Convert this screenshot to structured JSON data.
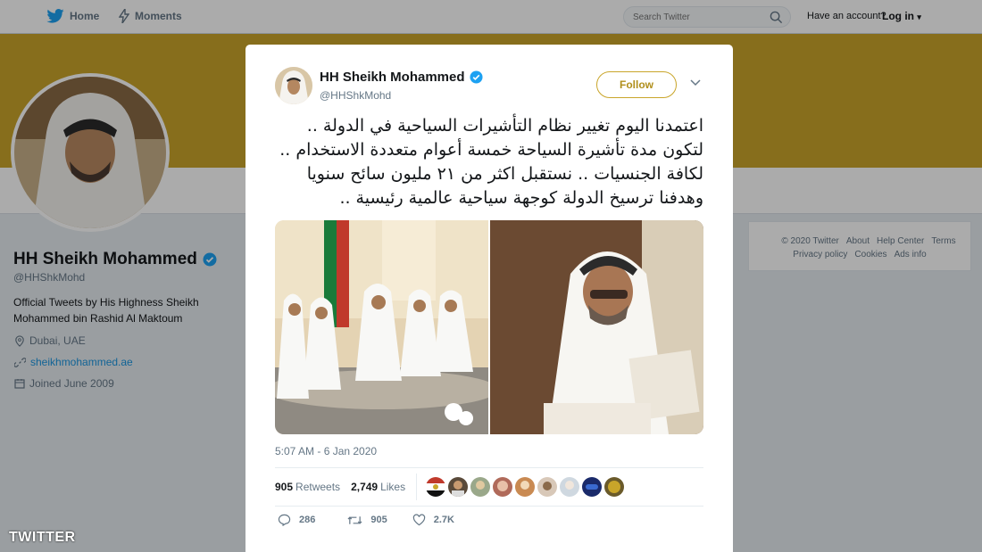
{
  "topnav": {
    "home_label": "Home",
    "moments_label": "Moments",
    "search_placeholder": "Search Twitter",
    "have_account": "Have an account?",
    "login_label": "Log in"
  },
  "profile": {
    "name": "HH Sheikh Mohammed",
    "handle": "@HHShkMohd",
    "bio": "Official Tweets by His Highness Sheikh Mohammed bin Rashid Al Maktoum",
    "location": "Dubai, UAE",
    "url": "sheikhmohammed.ae",
    "joined": "Joined June 2009"
  },
  "footer": {
    "row1": [
      "© 2020 Twitter",
      "About",
      "Help Center",
      "Terms"
    ],
    "row2": [
      "Privacy policy",
      "Cookies",
      "Ads info"
    ]
  },
  "tweet": {
    "author_name": "HH Sheikh Mohammed",
    "author_handle": "@HHShkMohd",
    "follow_label": "Follow",
    "text": "اعتمدنا اليوم تغيير نظام التأشيرات السياحية في الدولة .. لتكون مدة تأشيرة السياحة خمسة أعوام متعددة الاستخدام .. لكافة الجنسيات .. نستقبل اكثر من ٢١ مليون سائح سنويا وهدفنا ترسيخ الدولة كوجهة سياحية عالمية رئيسية ..",
    "timestamp": "5:07 AM - 6 Jan 2020",
    "retweets_count": "905",
    "retweets_label": "Retweets",
    "likes_count": "2,749",
    "likes_label": "Likes",
    "reply_count": "286",
    "retweet_count_short": "905",
    "like_count_short": "2.7K"
  },
  "watermark": "TWITTER",
  "colors": {
    "banner": "#c9a52a",
    "follow_accent": "#b08f1c",
    "link": "#1b95e0",
    "verified": "#1da1f2"
  }
}
